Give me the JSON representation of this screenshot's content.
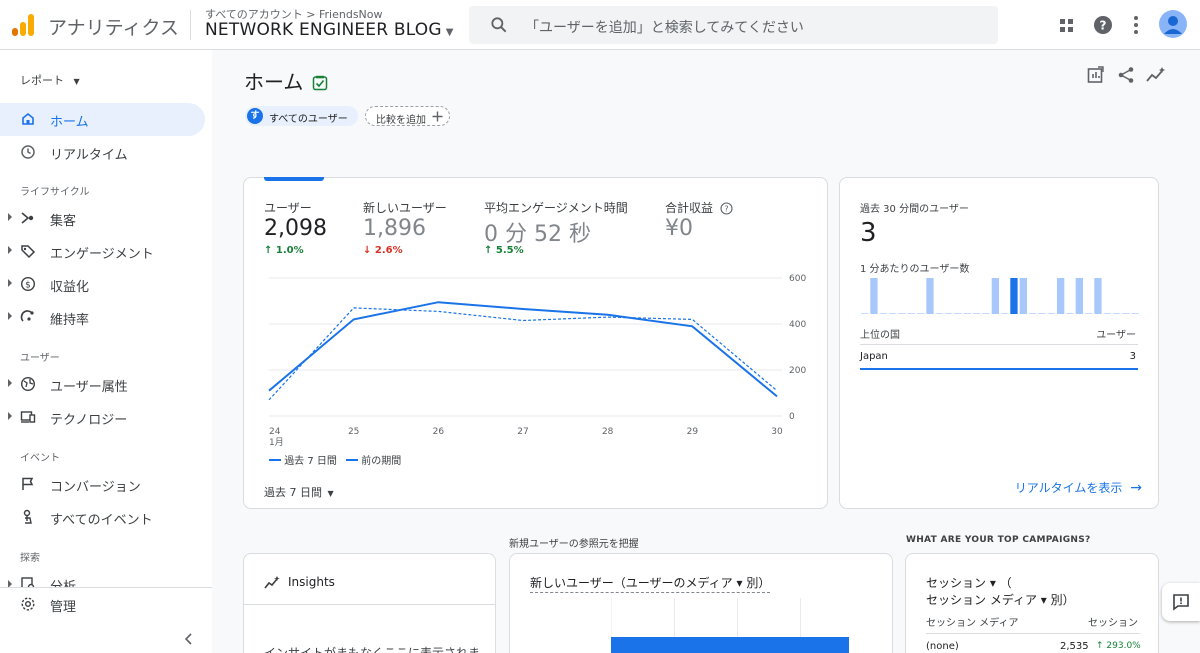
{
  "header": {
    "app_name": "アナリティクス",
    "breadcrumb": "すべてのアカウント > FriendsNow",
    "property": "NETWORK ENGINEER BLOG",
    "search_placeholder": "「ユーザーを追加」と検索してみてください"
  },
  "nav": {
    "reports_label": "レポート",
    "home": "ホーム",
    "realtime": "リアルタイム",
    "lifecycle_label": "ライフサイクル",
    "acquisition": "集客",
    "engagement": "エンゲージメント",
    "monetization": "収益化",
    "retention": "維持率",
    "user_label": "ユーザー",
    "user_attributes": "ユーザー属性",
    "tech": "テクノロジー",
    "event_label": "イベント",
    "conversions": "コンバージョン",
    "all_events": "すべてのイベント",
    "explore_label": "探索",
    "analysis": "分析",
    "admin": "管理"
  },
  "main": {
    "title": "ホーム",
    "segment_chip": "すべてのユーザー",
    "segment_avatar": "す",
    "compare_chip": "比較を追加"
  },
  "metrics": [
    {
      "label": "ユーザー",
      "value": "2,098",
      "delta": "1.0%",
      "dir": "up"
    },
    {
      "label": "新しいユーザー",
      "value": "1,896",
      "delta": "2.6%",
      "dir": "down"
    },
    {
      "label": "平均エンゲージメント時間",
      "value": "0 分 52 秒",
      "delta": "5.5%",
      "dir": "up"
    },
    {
      "label": "合計収益",
      "value": "¥0",
      "delta": "",
      "dir": ""
    }
  ],
  "chart_data": {
    "type": "line",
    "x": [
      "24",
      "25",
      "26",
      "27",
      "28",
      "29",
      "30"
    ],
    "x_month_label": "1月",
    "y_ticks": [
      "600",
      "400",
      "200",
      "0"
    ],
    "ylim": [
      0,
      600
    ],
    "series": [
      {
        "name": "過去 7 日間",
        "values": [
          110,
          420,
          495,
          465,
          440,
          390,
          85
        ]
      },
      {
        "name": "前の期間",
        "values": [
          70,
          470,
          455,
          415,
          430,
          420,
          110
        ]
      }
    ],
    "period_selector": "過去 7 日間"
  },
  "realtime": {
    "title": "過去 30 分間のユーザー",
    "value": "3",
    "per_minute_label": "1 分あたりのユーザー数",
    "bars": [
      0,
      1,
      0,
      0,
      0,
      0,
      0,
      1,
      0,
      0,
      0,
      0,
      0,
      0,
      1,
      0,
      2,
      1,
      0,
      0,
      0,
      1,
      0,
      1,
      0,
      1,
      0,
      0,
      0,
      0
    ],
    "table_col1": "上位の国",
    "table_col2": "ユーザー",
    "country": "Japan",
    "country_value": "3",
    "link": "リアルタイムを表示"
  },
  "bottom": {
    "section1_heading": "新規ユーザーの参照元を把握",
    "section2_heading": "WHAT ARE YOUR TOP CAMPAIGNS?",
    "insights_title": "Insights",
    "insights_text": "インサイトがまもなくここに表示されま",
    "new_users_title": "新しいユーザー（ユーザーのメディア ▾ 別）",
    "sessions_title_1": "セッション ▾ （",
    "sessions_title_2": "セッション メディア ▾ 別）",
    "sessions_col1": "セッション メディア",
    "sessions_col2": "セッション",
    "row_label": "(none)",
    "row_value": "2,535",
    "row_delta": "293.0%"
  }
}
